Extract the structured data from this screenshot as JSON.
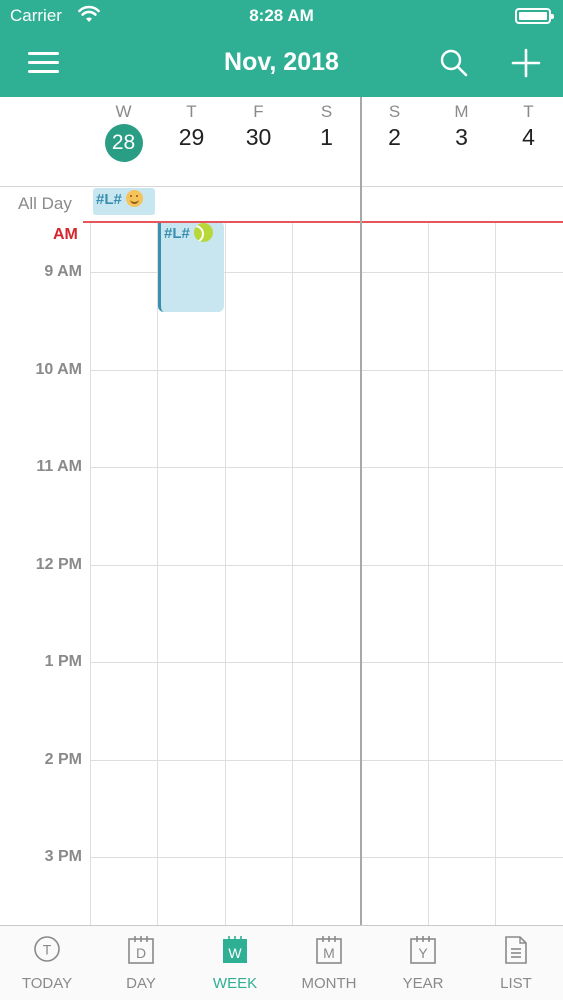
{
  "status_bar": {
    "carrier": "Carrier",
    "time": "8:28 AM"
  },
  "nav": {
    "title": "Nov, 2018"
  },
  "days": [
    {
      "letter": "W",
      "number": "28",
      "today": true
    },
    {
      "letter": "T",
      "number": "29",
      "today": false
    },
    {
      "letter": "F",
      "number": "30",
      "today": false
    },
    {
      "letter": "S",
      "number": "1",
      "today": false
    },
    {
      "letter": "S",
      "number": "2",
      "today": false
    },
    {
      "letter": "M",
      "number": "3",
      "today": false
    },
    {
      "letter": "T",
      "number": "4",
      "today": false
    }
  ],
  "allday": {
    "label": "All Day",
    "event": {
      "title": "#L#",
      "emoji": "smile-emoji"
    }
  },
  "now_label": "AM",
  "hours": [
    "9 AM",
    "10 AM",
    "11 AM",
    "12 PM",
    "1 PM",
    "2 PM",
    "3 PM"
  ],
  "event": {
    "title": "#L#",
    "emoji": "tennis-ball-emoji"
  },
  "colors": {
    "accent": "#2fb094",
    "today_circle": "#2a9d85",
    "now_line": "#e6565b",
    "event_bg": "#c7e6ef",
    "event_text": "#3a8fb0"
  },
  "tabs": [
    {
      "key": "today",
      "label": "TODAY",
      "glyph": "T",
      "icon": "today-icon",
      "active": false
    },
    {
      "key": "day",
      "label": "DAY",
      "glyph": "D",
      "icon": "day-calendar-icon",
      "active": false
    },
    {
      "key": "week",
      "label": "WEEK",
      "glyph": "W",
      "icon": "week-calendar-icon",
      "active": true
    },
    {
      "key": "month",
      "label": "MONTH",
      "glyph": "M",
      "icon": "month-calendar-icon",
      "active": false
    },
    {
      "key": "year",
      "label": "YEAR",
      "glyph": "Y",
      "icon": "year-calendar-icon",
      "active": false
    },
    {
      "key": "list",
      "label": "LIST",
      "glyph": "",
      "icon": "list-document-icon",
      "active": false
    }
  ]
}
